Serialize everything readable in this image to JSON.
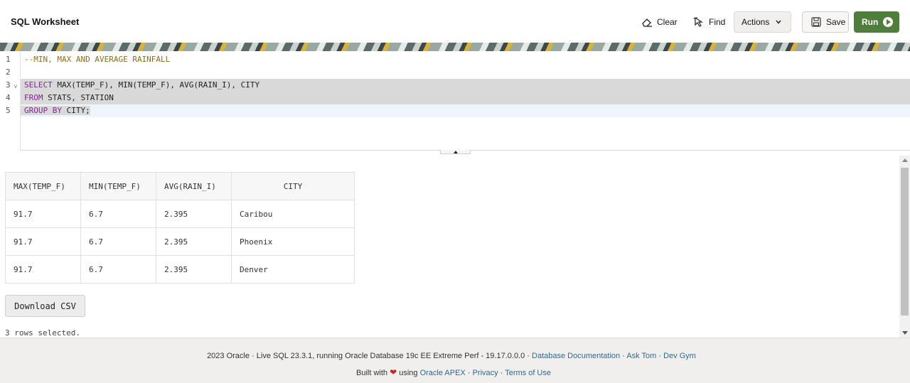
{
  "header": {
    "title": "SQL Worksheet",
    "clear_label": "Clear",
    "find_label": "Find",
    "actions_label": "Actions",
    "save_label": "Save",
    "run_label": "Run"
  },
  "editor": {
    "lines": [
      {
        "num": "1",
        "text": "--MIN, MAX AND AVERAGE RAINFALL"
      },
      {
        "num": "2",
        "text": ""
      },
      {
        "num": "3",
        "kw": "SELECT",
        "text": " MAX(TEMP_F), MIN(TEMP_F), AVG(RAIN_I), CITY"
      },
      {
        "num": "4",
        "kw": "FROM",
        "text": " STATS, STATION"
      },
      {
        "num": "5",
        "kw": "GROUP BY",
        "text": " CITY;"
      }
    ]
  },
  "results": {
    "columns": [
      "MAX(TEMP_F)",
      "MIN(TEMP_F)",
      "AVG(RAIN_I)",
      "CITY"
    ],
    "rows": [
      [
        "91.7",
        "6.7",
        "2.395",
        "Caribou"
      ],
      [
        "91.7",
        "6.7",
        "2.395",
        "Phoenix"
      ],
      [
        "91.7",
        "6.7",
        "2.395",
        "Denver"
      ]
    ],
    "download_label": "Download CSV",
    "rows_selected": "3 rows selected."
  },
  "footer": {
    "line1_text": "2023 Oracle · Live SQL 23.3.1, running Oracle Database 19c EE Extreme Perf - 19.17.0.0.0 · ",
    "link_docs": "Database Documentation",
    "sep": " · ",
    "link_asktom": "Ask Tom",
    "link_devgym": "Dev Gym",
    "built_with": "Built with",
    "using": "using",
    "link_apex": "Oracle APEX",
    "link_privacy": "Privacy",
    "link_terms": "Terms of Use"
  },
  "colors": {
    "run_button": "#4f7d3c",
    "link": "#2c6a8f",
    "keyword": "#7a2a89",
    "comment": "#8a6d1f"
  }
}
